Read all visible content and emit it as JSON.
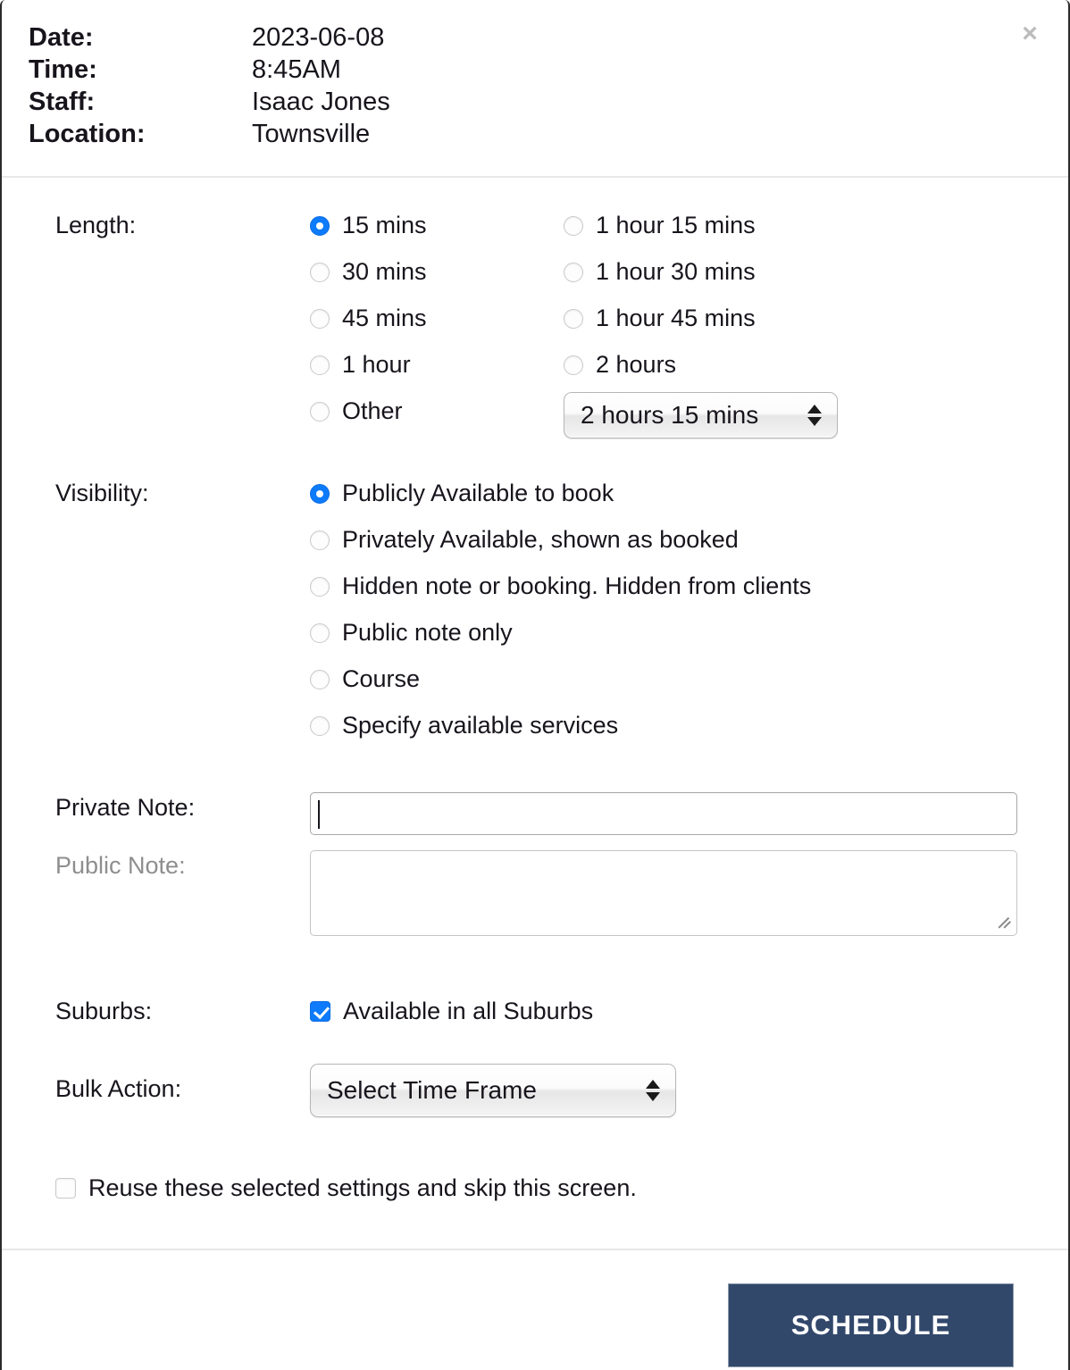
{
  "header": {
    "rows": [
      {
        "label": "Date:",
        "value": "2023-06-08"
      },
      {
        "label": "Time:",
        "value": "8:45AM"
      },
      {
        "label": "Staff:",
        "value": "Isaac Jones"
      },
      {
        "label": "Location:",
        "value": "Townsville"
      }
    ],
    "close_label": "×"
  },
  "length": {
    "label": "Length:",
    "options_left": [
      {
        "label": "15 mins",
        "selected": true
      },
      {
        "label": "30 mins",
        "selected": false
      },
      {
        "label": "45 mins",
        "selected": false
      },
      {
        "label": "1 hour",
        "selected": false
      },
      {
        "label": "Other",
        "selected": false
      }
    ],
    "options_right": [
      {
        "label": "1 hour 15 mins",
        "selected": false
      },
      {
        "label": "1 hour 30 mins",
        "selected": false
      },
      {
        "label": "1 hour 45 mins",
        "selected": false
      },
      {
        "label": "2 hours",
        "selected": false
      }
    ],
    "other_select_value": "2 hours 15 mins"
  },
  "visibility": {
    "label": "Visibility:",
    "options": [
      {
        "label": "Publicly Available to book",
        "selected": true
      },
      {
        "label": "Privately Available, shown as booked",
        "selected": false
      },
      {
        "label": "Hidden note or booking. Hidden from clients",
        "selected": false
      },
      {
        "label": "Public note only",
        "selected": false
      },
      {
        "label": "Course",
        "selected": false
      },
      {
        "label": "Specify available services",
        "selected": false
      }
    ]
  },
  "notes": {
    "private_label": "Private Note:",
    "private_value": "",
    "private_placeholder": "",
    "public_label": "Public Note:",
    "public_value": "",
    "public_placeholder": ""
  },
  "suburbs": {
    "label": "Suburbs:",
    "checkbox_label": "Available in all Suburbs",
    "checked": true
  },
  "bulk_action": {
    "label": "Bulk Action:",
    "select_value": "Select Time Frame"
  },
  "reuse": {
    "label": "Reuse these selected settings and skip this screen.",
    "checked": false
  },
  "footer": {
    "schedule_label": "SCHEDULE"
  },
  "colors": {
    "accent_blue": "#0d7bfb",
    "button_navy": "#32486b",
    "close_gray": "#bcbcbc",
    "muted_label": "#8e8e8e"
  }
}
